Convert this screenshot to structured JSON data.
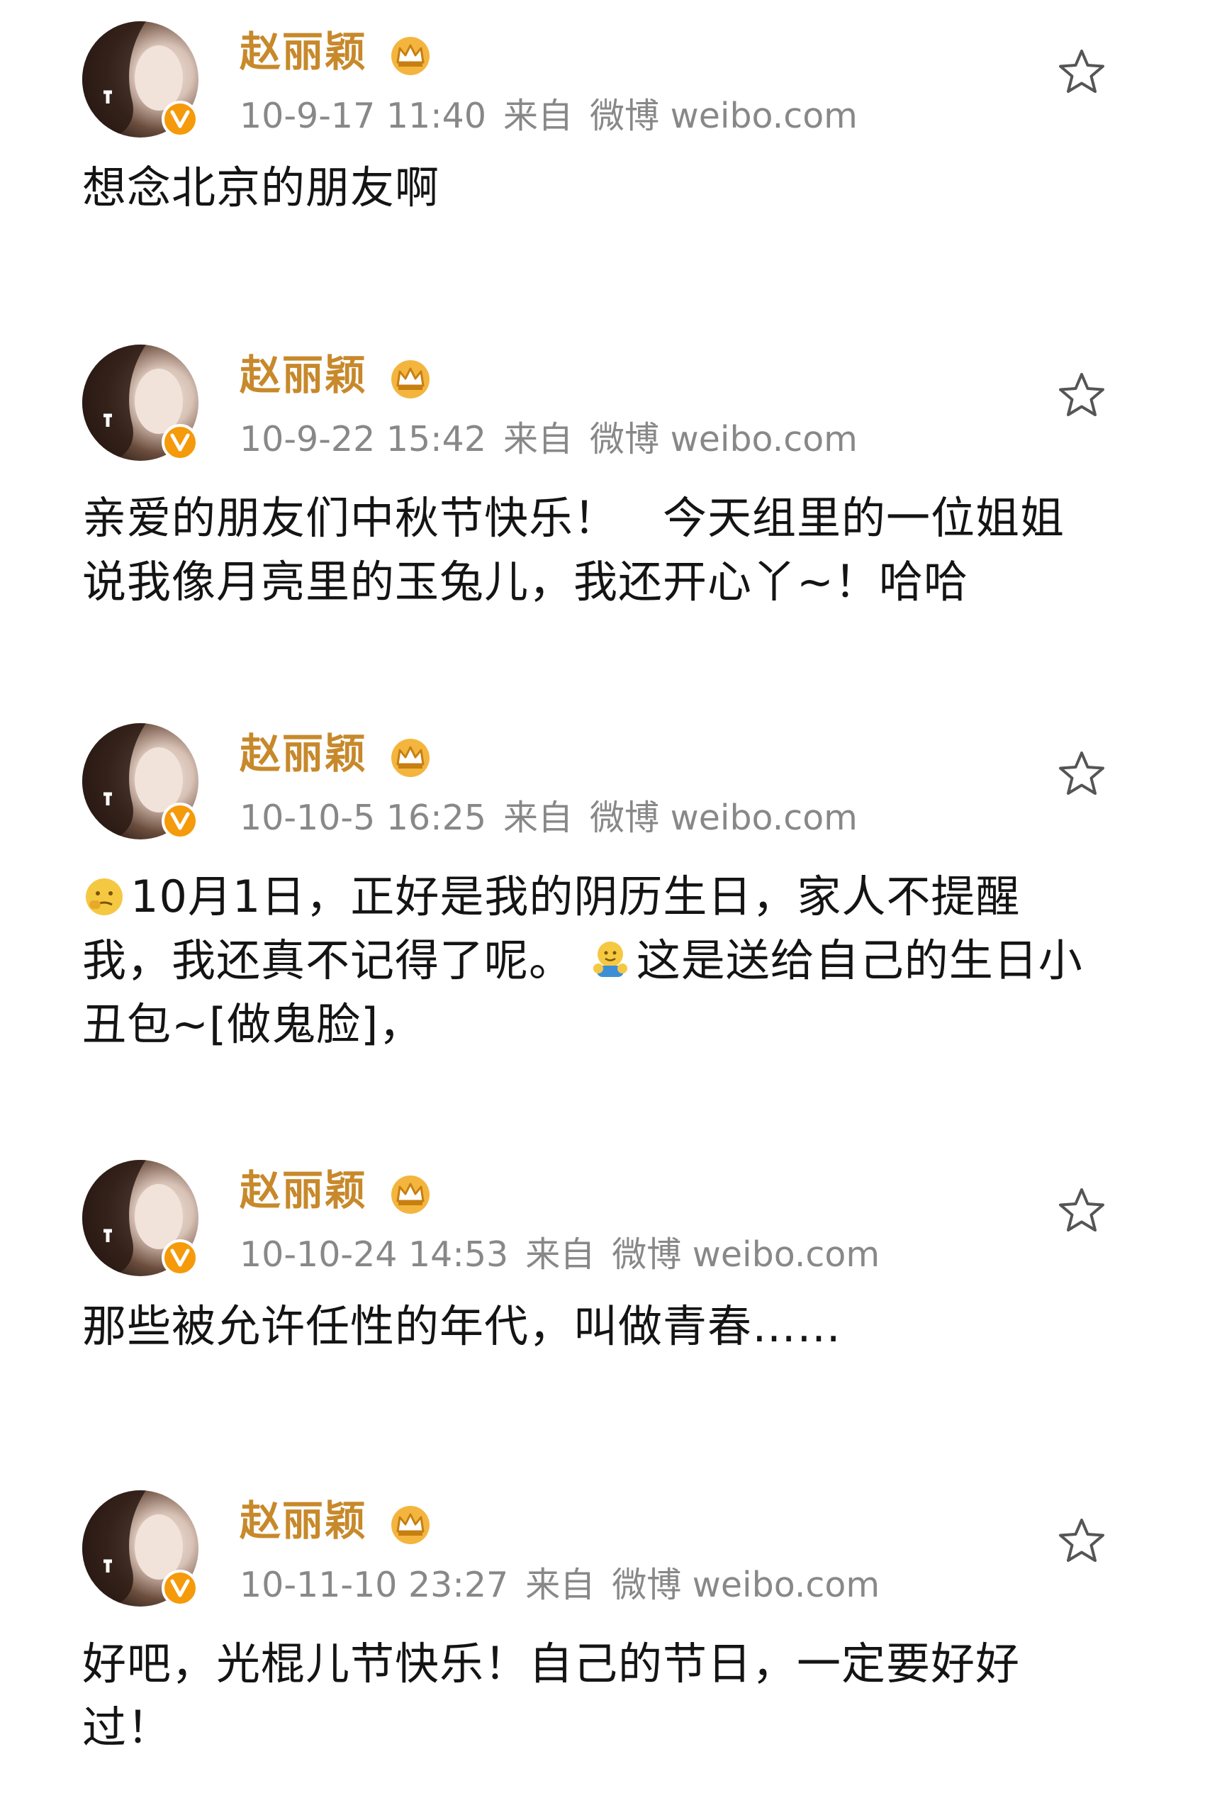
{
  "colors": {
    "username": "#c7892b",
    "meta": "#888888",
    "badge": "#f59a0b",
    "text": "#141414"
  },
  "posts": [
    {
      "username": "赵丽颖",
      "time": "10-9-17 11:40",
      "source_prefix": "来自",
      "source": "微博 weibo.com",
      "lines": [
        "想念北京的朋友啊"
      ]
    },
    {
      "username": "赵丽颖",
      "time": "10-9-22 15:42",
      "source_prefix": "来自",
      "source": "微博 weibo.com",
      "lines": [
        "亲爱的朋友们中秋节快乐！　今天组里的一位姐姐",
        "说我像月亮里的玉兔儿，我还开心丫~！哈哈"
      ]
    },
    {
      "username": "赵丽颖",
      "time": "10-10-5 16:25",
      "source_prefix": "来自",
      "source": "微博 weibo.com",
      "lines": [
        "10月1日，正好是我的阴历生日，家人不提醒",
        "我，我还真不记得了呢。",
        "这是送给自己的生日小",
        "丑包~[做鬼脸]，"
      ]
    },
    {
      "username": "赵丽颖",
      "time": "10-10-24 14:53",
      "source_prefix": "来自",
      "source": "微博 weibo.com",
      "lines": [
        "那些被允许任性的年代，叫做青春……"
      ]
    },
    {
      "username": "赵丽颖",
      "time": "10-11-10 23:27",
      "source_prefix": "来自",
      "source": "微博 weibo.com",
      "lines": [
        "好吧，光棍儿节快乐！自己的节日，一定要好好",
        "过！"
      ]
    }
  ],
  "icons": {
    "star": "star-outline-icon",
    "crown": "crown-icon",
    "verified": "verified-badge-icon"
  }
}
